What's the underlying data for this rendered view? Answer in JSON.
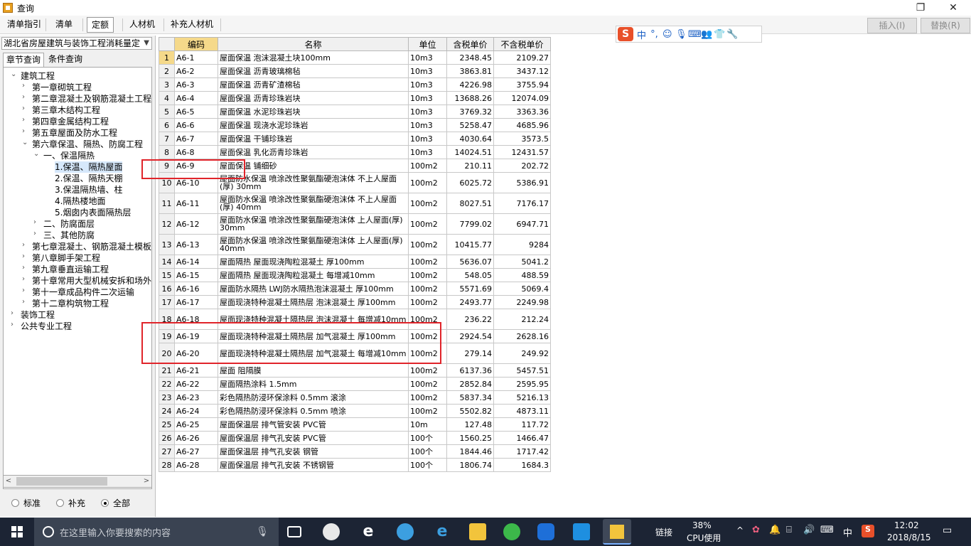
{
  "window": {
    "title": "查询"
  },
  "toolbar": {
    "tabs": [
      "清单指引",
      "清单",
      "定额",
      "人材机",
      "补充人材机"
    ],
    "insert_label": "插入(I)",
    "replace_label": "替换(R)"
  },
  "ime": {
    "logo": "S",
    "lang": "中",
    "punct": "°,"
  },
  "library": {
    "selected": "湖北省房屋建筑与装饰工程消耗量定"
  },
  "search_tabs": [
    "章节查询",
    "条件查询"
  ],
  "tree": [
    {
      "label": "建筑工程",
      "level": 0,
      "toggle": "v"
    },
    {
      "label": "第一章砌筑工程",
      "level": 1,
      "toggle": ">"
    },
    {
      "label": "第二章混凝土及钢筋混凝土工程",
      "level": 1,
      "toggle": ">"
    },
    {
      "label": "第三章木结构工程",
      "level": 1,
      "toggle": ">"
    },
    {
      "label": "第四章金属结构工程",
      "level": 1,
      "toggle": ">"
    },
    {
      "label": "第五章屋面及防水工程",
      "level": 1,
      "toggle": ">"
    },
    {
      "label": "第六章保温、隔热、防腐工程",
      "level": 1,
      "toggle": "v"
    },
    {
      "label": "一、保温隔热",
      "level": 2,
      "toggle": "v"
    },
    {
      "label": "1.保温、隔热屋面",
      "level": 3,
      "toggle": "",
      "selected": true
    },
    {
      "label": "2.保温、隔热天棚",
      "level": 3,
      "toggle": ""
    },
    {
      "label": "3.保温隔热墙、柱",
      "level": 3,
      "toggle": ""
    },
    {
      "label": "4.隔热楼地面",
      "level": 3,
      "toggle": ""
    },
    {
      "label": "5.烟囱内表面隔热层",
      "level": 3,
      "toggle": ""
    },
    {
      "label": "二、防腐面层",
      "level": 2,
      "toggle": ">"
    },
    {
      "label": "三、其他防腐",
      "level": 2,
      "toggle": ">"
    },
    {
      "label": "第七章混凝土、钢筋混凝土模板",
      "level": 1,
      "toggle": ">"
    },
    {
      "label": "第八章脚手架工程",
      "level": 1,
      "toggle": ">"
    },
    {
      "label": "第九章垂直运输工程",
      "level": 1,
      "toggle": ">"
    },
    {
      "label": "第十章常用大型机械安拆和场外",
      "level": 1,
      "toggle": ">"
    },
    {
      "label": "第十一章成品构件二次运输",
      "level": 1,
      "toggle": ">"
    },
    {
      "label": "第十二章构筑物工程",
      "level": 1,
      "toggle": ">"
    },
    {
      "label": "装饰工程",
      "level": 0,
      "toggle": ">"
    },
    {
      "label": "公共专业工程",
      "level": 0,
      "toggle": ">"
    }
  ],
  "filter": {
    "options": [
      "标准",
      "补充",
      "全部"
    ],
    "selected": "全部"
  },
  "grid": {
    "columns": [
      "",
      "编码",
      "名称",
      "单位",
      "含税单价",
      "不含税单价"
    ],
    "rows": [
      [
        "1",
        "A6-1",
        "屋面保温 泡沫混凝土块100mm",
        "10m3",
        "2348.45",
        "2109.27"
      ],
      [
        "2",
        "A6-2",
        "屋面保温 沥青玻璃棉毡",
        "10m3",
        "3863.81",
        "3437.12"
      ],
      [
        "3",
        "A6-3",
        "屋面保温 沥青矿渣棉毡",
        "10m3",
        "4226.98",
        "3755.94"
      ],
      [
        "4",
        "A6-4",
        "屋面保温 沥青珍珠岩块",
        "10m3",
        "13688.26",
        "12074.09"
      ],
      [
        "5",
        "A6-5",
        "屋面保温 水泥珍珠岩块",
        "10m3",
        "3769.32",
        "3363.36"
      ],
      [
        "6",
        "A6-6",
        "屋面保温 现浇水泥珍珠岩",
        "10m3",
        "5258.47",
        "4685.96"
      ],
      [
        "7",
        "A6-7",
        "屋面保温 干铺珍珠岩",
        "10m3",
        "4030.64",
        "3573.5"
      ],
      [
        "8",
        "A6-8",
        "屋面保温 乳化沥青珍珠岩",
        "10m3",
        "14024.51",
        "12431.57"
      ],
      [
        "9",
        "A6-9",
        "屋面保温 铺细砂",
        "100m2",
        "210.11",
        "202.72"
      ],
      [
        "10",
        "A6-10",
        "屋面防水保温 喷涂改性聚氨酯硬泡沫体 不上人屋面(厚) 30mm",
        "100m2",
        "6025.72",
        "5386.91"
      ],
      [
        "11",
        "A6-11",
        "屋面防水保温 喷涂改性聚氨酯硬泡沫体 不上人屋面(厚) 40mm",
        "100m2",
        "8027.51",
        "7176.17"
      ],
      [
        "12",
        "A6-12",
        "屋面防水保温 喷涂改性聚氨酯硬泡沫体 上人屋面(厚) 30mm",
        "100m2",
        "7799.02",
        "6947.71"
      ],
      [
        "13",
        "A6-13",
        "屋面防水保温 喷涂改性聚氨酯硬泡沫体 上人屋面(厚) 40mm",
        "100m2",
        "10415.77",
        "9284"
      ],
      [
        "14",
        "A6-14",
        "屋面隔热 屋面现浇陶粒混凝土 厚100mm",
        "100m2",
        "5636.07",
        "5041.2"
      ],
      [
        "15",
        "A6-15",
        "屋面隔热 屋面现浇陶粒混凝土 每增减10mm",
        "100m2",
        "548.05",
        "488.59"
      ],
      [
        "16",
        "A6-16",
        "屋面防水隔热 LWJ防水隔热泡沫混凝土 厚100mm",
        "100m2",
        "5571.69",
        "5069.4"
      ],
      [
        "17",
        "A6-17",
        "屋面现浇特种混凝土隔热层 泡沫混凝土 厚100mm",
        "100m2",
        "2493.77",
        "2249.98"
      ],
      [
        "18",
        "A6-18",
        "屋面现浇特种混凝土隔热层 泡沫混凝土 每增减10mm",
        "100m2",
        "236.22",
        "212.24"
      ],
      [
        "19",
        "A6-19",
        "屋面现浇特种混凝土隔热层 加气混凝土 厚100mm",
        "100m2",
        "2924.54",
        "2628.16"
      ],
      [
        "20",
        "A6-20",
        "屋面现浇特种混凝土隔热层 加气混凝土 每增减10mm",
        "100m2",
        "279.14",
        "249.92"
      ],
      [
        "21",
        "A6-21",
        "屋面 阻隔膜",
        "100m2",
        "6137.36",
        "5457.51"
      ],
      [
        "22",
        "A6-22",
        "屋面隔热涂料 1.5mm",
        "100m2",
        "2852.84",
        "2595.95"
      ],
      [
        "23",
        "A6-23",
        "彩色隔热防浸环保涂料 0.5mm 滚涂",
        "100m2",
        "5837.34",
        "5216.13"
      ],
      [
        "24",
        "A6-24",
        "彩色隔热防浸环保涂料 0.5mm 喷涂",
        "100m2",
        "5502.82",
        "4873.11"
      ],
      [
        "25",
        "A6-25",
        "屋面保温层 排气管安装 PVC管",
        "10m",
        "127.48",
        "117.72"
      ],
      [
        "26",
        "A6-26",
        "屋面保温层 排气孔安装 PVC管",
        "100个",
        "1560.25",
        "1466.47"
      ],
      [
        "27",
        "A6-27",
        "屋面保温层 排气孔安装 钢管",
        "100个",
        "1844.46",
        "1717.42"
      ],
      [
        "28",
        "A6-28",
        "屋面保温层 排气孔安装 不锈钢管",
        "100个",
        "1806.74",
        "1684.3"
      ]
    ]
  },
  "taskbar": {
    "search_placeholder": "在这里输入你要搜索的内容",
    "link_label": "链接",
    "cpu_percent": "38%",
    "cpu_label": "CPU使用",
    "ime_lang": "中",
    "time": "12:02",
    "date": "2018/8/15"
  }
}
